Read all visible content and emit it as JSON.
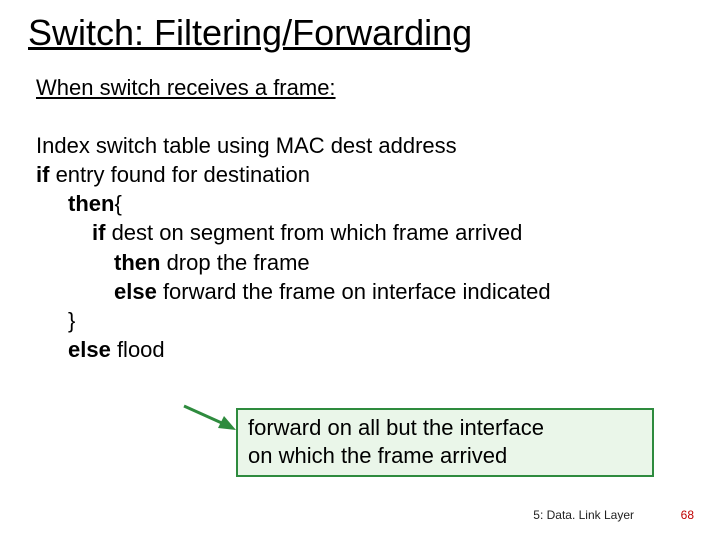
{
  "title": "Switch: Filtering/Forwarding",
  "subhead": "When switch receives a frame:",
  "lines": {
    "l1": "Index switch table using MAC dest address",
    "l2a": "if",
    "l2b": " entry found for destination",
    "l3a": "then",
    "l3b": "{",
    "l4a": "if",
    "l4b": " dest on segment from which frame arrived",
    "l5a": "then",
    "l5b": " drop the frame",
    "l6a": "else",
    "l6b": " forward the frame on interface indicated",
    "l7": "}",
    "l8a": "else",
    "l8b": " flood"
  },
  "callout": {
    "line1": "forward on all but the interface",
    "line2": "on which the frame arrived"
  },
  "footer": {
    "section": "5: Data. Link Layer",
    "page": "68"
  }
}
